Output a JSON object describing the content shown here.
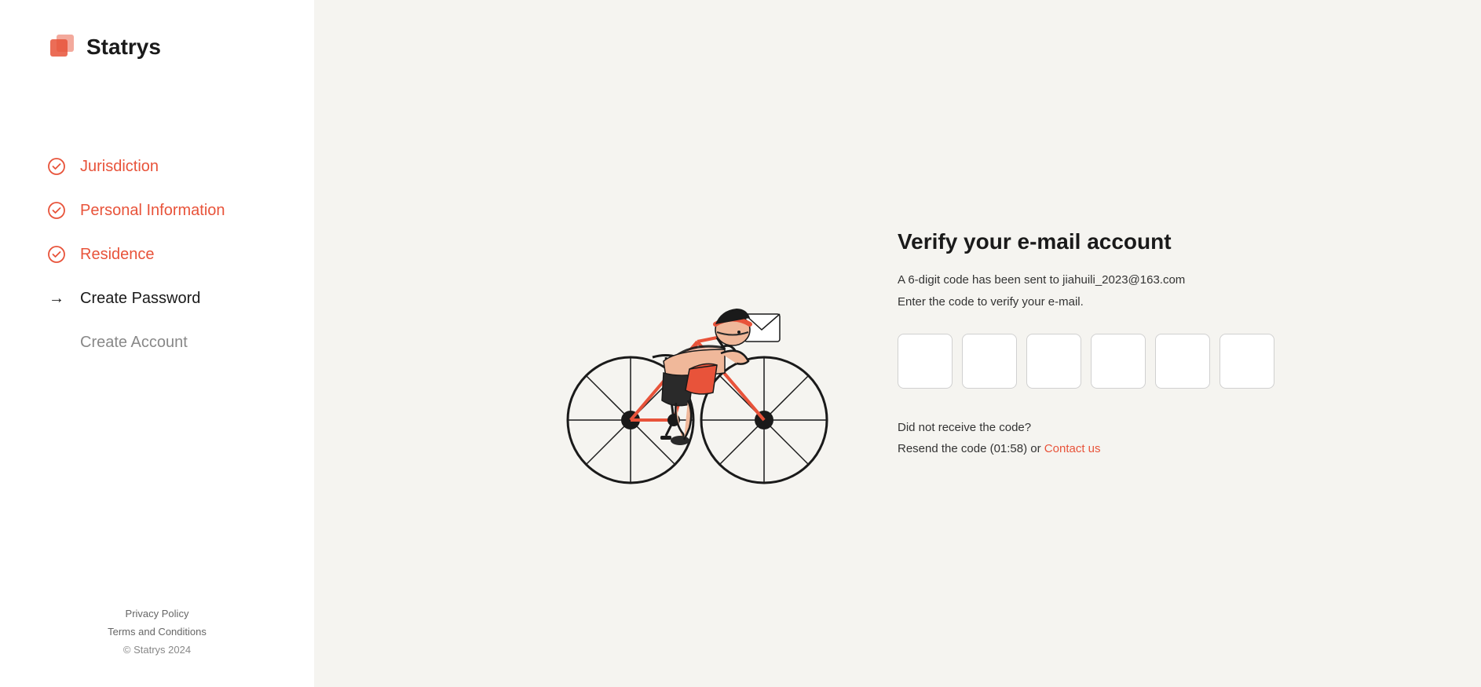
{
  "logo": {
    "text": "Statrys"
  },
  "sidebar": {
    "steps": [
      {
        "id": "jurisdiction",
        "label": "Jurisdiction",
        "state": "completed",
        "icon": "check-circle"
      },
      {
        "id": "personal-information",
        "label": "Personal Information",
        "state": "completed",
        "icon": "check-circle"
      },
      {
        "id": "residence",
        "label": "Residence",
        "state": "completed",
        "icon": "check-circle"
      },
      {
        "id": "create-password",
        "label": "Create Password",
        "state": "active",
        "icon": "arrow"
      },
      {
        "id": "create-account",
        "label": "Create Account",
        "state": "inactive",
        "icon": "none"
      }
    ]
  },
  "footer": {
    "privacy_policy": "Privacy Policy",
    "terms": "Terms and Conditions",
    "copyright": "© Statrys 2024"
  },
  "verify": {
    "title": "Verify your e-mail account",
    "subtitle": "A 6-digit code has been sent to jiahuili_2023@163.com",
    "instruction": "Enter the code to verify your e-mail.",
    "resend_text": "Did not receive the code?",
    "resend_timer": "Resend the code (01:58) or",
    "contact_link": "Contact us"
  },
  "colors": {
    "accent": "#e8533a",
    "text_primary": "#1a1a1a",
    "text_secondary": "#666666",
    "border": "#d0d0d0"
  }
}
